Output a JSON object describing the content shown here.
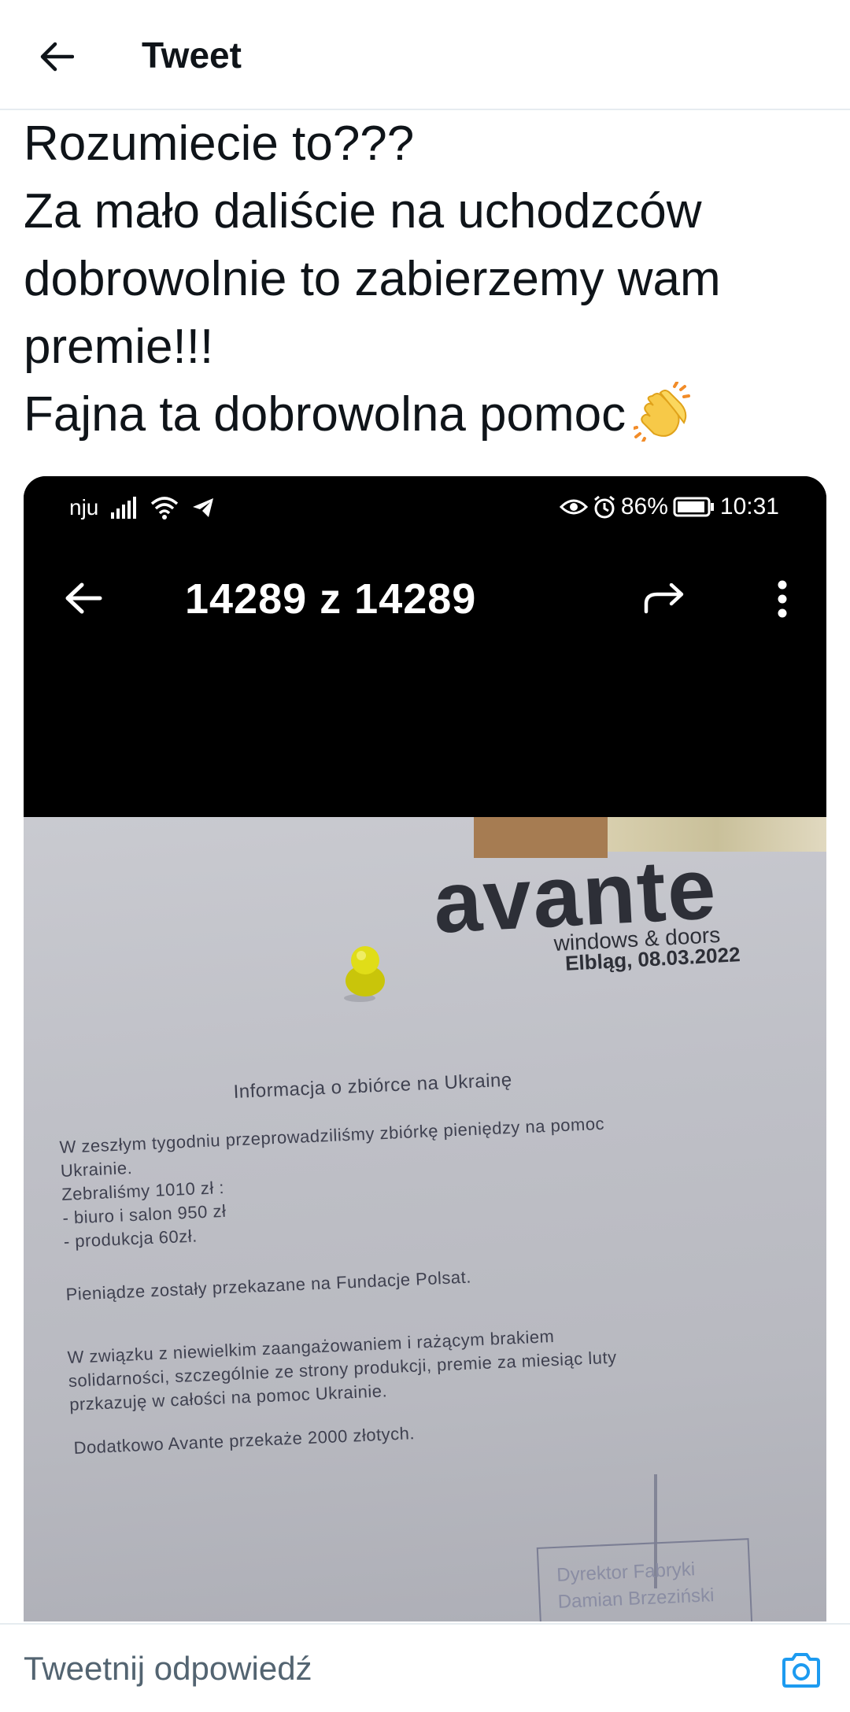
{
  "header": {
    "title": "Tweet",
    "back_icon": "arrow-left-icon"
  },
  "tweet": {
    "lines": [
      "Rozumiecie to???",
      "Za mało daliście na uchodzców",
      "dobrowolnie to zabierzemy wam",
      "premie!!!",
      "Fajna ta dobrowolna pomoc"
    ],
    "emoji": "clapping-hands"
  },
  "media": {
    "status_bar": {
      "carrier": "nju",
      "battery": "86%",
      "time": "10:31"
    },
    "viewer": {
      "counter": "14289 z 14289",
      "back_icon": "arrow-left-icon",
      "share_icon": "share-icon",
      "more_icon": "more-vertical-icon"
    },
    "document": {
      "logo": "avante",
      "logo_sub": "windows & doors",
      "date": "Elbląg, 08.03.2022",
      "heading": "Informacja o zbiórce na Ukrainę",
      "p1_lines": [
        "W zeszłym tygodniu przeprowadziliśmy zbiórkę pieniędzy na pomoc",
        "Ukrainie.",
        "Zebraliśmy 1010 zł :",
        "- biuro i salon 950 zł",
        "- produkcja 60zł."
      ],
      "p2": "Pieniądze zostały przekazane na Fundacje Polsat.",
      "p3_lines": [
        "W  związku  z  niewielkim  zaangażowaniem  i  rażącym  brakiem",
        "solidarności, szczególnie ze strony produkcji, premie za miesiąc luty",
        "przkazuję w całości na pomoc Ukrainie."
      ],
      "p4": "Dodatkowo Avante przekaże 2000 złotych.",
      "stamp_lines": [
        "Dyrektor Fabryki",
        "Damian Brzeziński"
      ]
    }
  },
  "reply": {
    "placeholder": "Tweetnij odpowiedź",
    "camera_icon": "camera-icon"
  },
  "colors": {
    "accent": "#1d9bf0",
    "text": "#0f1419",
    "muted": "#536471",
    "border": "#e6ecf0"
  }
}
